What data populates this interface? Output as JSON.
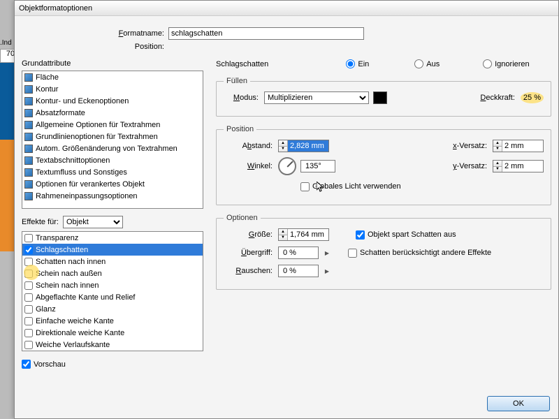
{
  "ruler": "70",
  "sidebarLabel": ".Ind",
  "dialog": {
    "title": "Objektformatoptionen",
    "formatname_label": "Formatname:",
    "formatname_value": "schlagschatten",
    "position_label": "Position:"
  },
  "left": {
    "grund_header": "Grundattribute",
    "attrs": [
      "Fläche",
      "Kontur",
      "Kontur- und Eckenoptionen",
      "Absatzformate",
      "Allgemeine Optionen für Textrahmen",
      "Grundlinienoptionen für Textrahmen",
      "Autom. Größenänderung von Textrahmen",
      "Textabschnittoptionen",
      "Textumfluss und Sonstiges",
      "Optionen für verankertes Objekt",
      "Rahmeneinpassungsoptionen"
    ],
    "effects_label": "Effekte für:",
    "effects_target": "Objekt",
    "effects": [
      {
        "label": "Transparenz",
        "checked": false,
        "selected": false
      },
      {
        "label": "Schlagschatten",
        "checked": true,
        "selected": true
      },
      {
        "label": "Schatten nach innen",
        "checked": false,
        "selected": false
      },
      {
        "label": "Schein nach außen",
        "checked": false,
        "selected": false
      },
      {
        "label": "Schein nach innen",
        "checked": false,
        "selected": false
      },
      {
        "label": "Abgeflachte Kante und Relief",
        "checked": false,
        "selected": false
      },
      {
        "label": "Glanz",
        "checked": false,
        "selected": false
      },
      {
        "label": "Einfache weiche Kante",
        "checked": false,
        "selected": false
      },
      {
        "label": "Direktionale weiche Kante",
        "checked": false,
        "selected": false
      },
      {
        "label": "Weiche Verlaufskante",
        "checked": false,
        "selected": false
      }
    ],
    "preview_label": "Vorschau"
  },
  "right": {
    "panel_title": "Schlagschatten",
    "radios": {
      "ein": "Ein",
      "aus": "Aus",
      "ign": "Ignorieren",
      "value": "ein"
    },
    "fuellen": {
      "legend": "Füllen",
      "modus_label": "Modus:",
      "modus_value": "Multiplizieren",
      "deck_label": "Deckkraft:",
      "deck_value": "25 %"
    },
    "position": {
      "legend": "Position",
      "abstand_label": "Abstand:",
      "abstand_value": "2,828 mm",
      "winkel_label": "Winkel:",
      "winkel_value": "135°",
      "global_label": "Globales Licht verwenden",
      "xv_label": "x-Versatz:",
      "xv_value": "2 mm",
      "yv_label": "y-Versatz:",
      "yv_value": "2 mm"
    },
    "optionen": {
      "legend": "Optionen",
      "groesse_label": "Größe:",
      "groesse_value": "1,764 mm",
      "uebergriff_label": "Übergriff:",
      "uebergriff_value": "0 %",
      "rauschen_label": "Rauschen:",
      "rauschen_value": "0 %",
      "spart_label": "Objekt spart Schatten aus",
      "andere_label": "Schatten berücksichtigt andere Effekte"
    }
  },
  "ok_label": "OK"
}
